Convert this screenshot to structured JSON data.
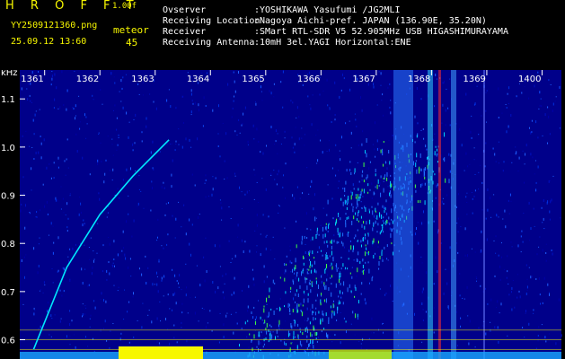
{
  "header": {
    "brand": "H R O F F T",
    "version": "1.00f",
    "filename": "YY2509121360.png",
    "datetime": "25.09.12 13:60",
    "meteor_label": "meteor",
    "meteor_count": "45",
    "info": [
      {
        "label": "Ovserver",
        "value": ":YOSHIKAWA Yasufumi /JG2MLI"
      },
      {
        "label": "Receiving Location",
        "value": ":Nagoya Aichi-pref. JAPAN (136.90E, 35.20N)"
      },
      {
        "label": "Receiver",
        "value": ":SMart RTL-SDR V5 52.905MHz USB HIGASHIMURAYAMA"
      },
      {
        "label": "Receiving Antenna",
        "value": ":10mH 3el.YAGI Horizontal:ENE"
      }
    ]
  },
  "colors": {
    "background": "#000000",
    "header_text": "#ffffff",
    "accent": "#f7f700",
    "plot_bg": "#00008a",
    "trail": "#00e8ff",
    "marker_lines": "#ffff00"
  },
  "chart_data": {
    "type": "heatmap",
    "title": "",
    "xlabel": "",
    "ylabel": "kHz",
    "x_ticks": [
      "1361",
      "1362",
      "1363",
      "1364",
      "1365",
      "1366",
      "1367",
      "1368",
      "1369",
      "1400"
    ],
    "y_ticks": [
      "1.1",
      "1.0",
      "0.9",
      "0.8",
      "0.7",
      "0.6"
    ],
    "ylim": [
      0.56,
      1.16
    ],
    "meteor_trail": {
      "x": [
        1360.8,
        1361.4,
        1362.0,
        1362.6,
        1363.25
      ],
      "y": [
        0.58,
        0.75,
        0.86,
        0.94,
        1.015
      ]
    },
    "reference_lines_khz": [
      0.62,
      0.6,
      0.58
    ]
  }
}
